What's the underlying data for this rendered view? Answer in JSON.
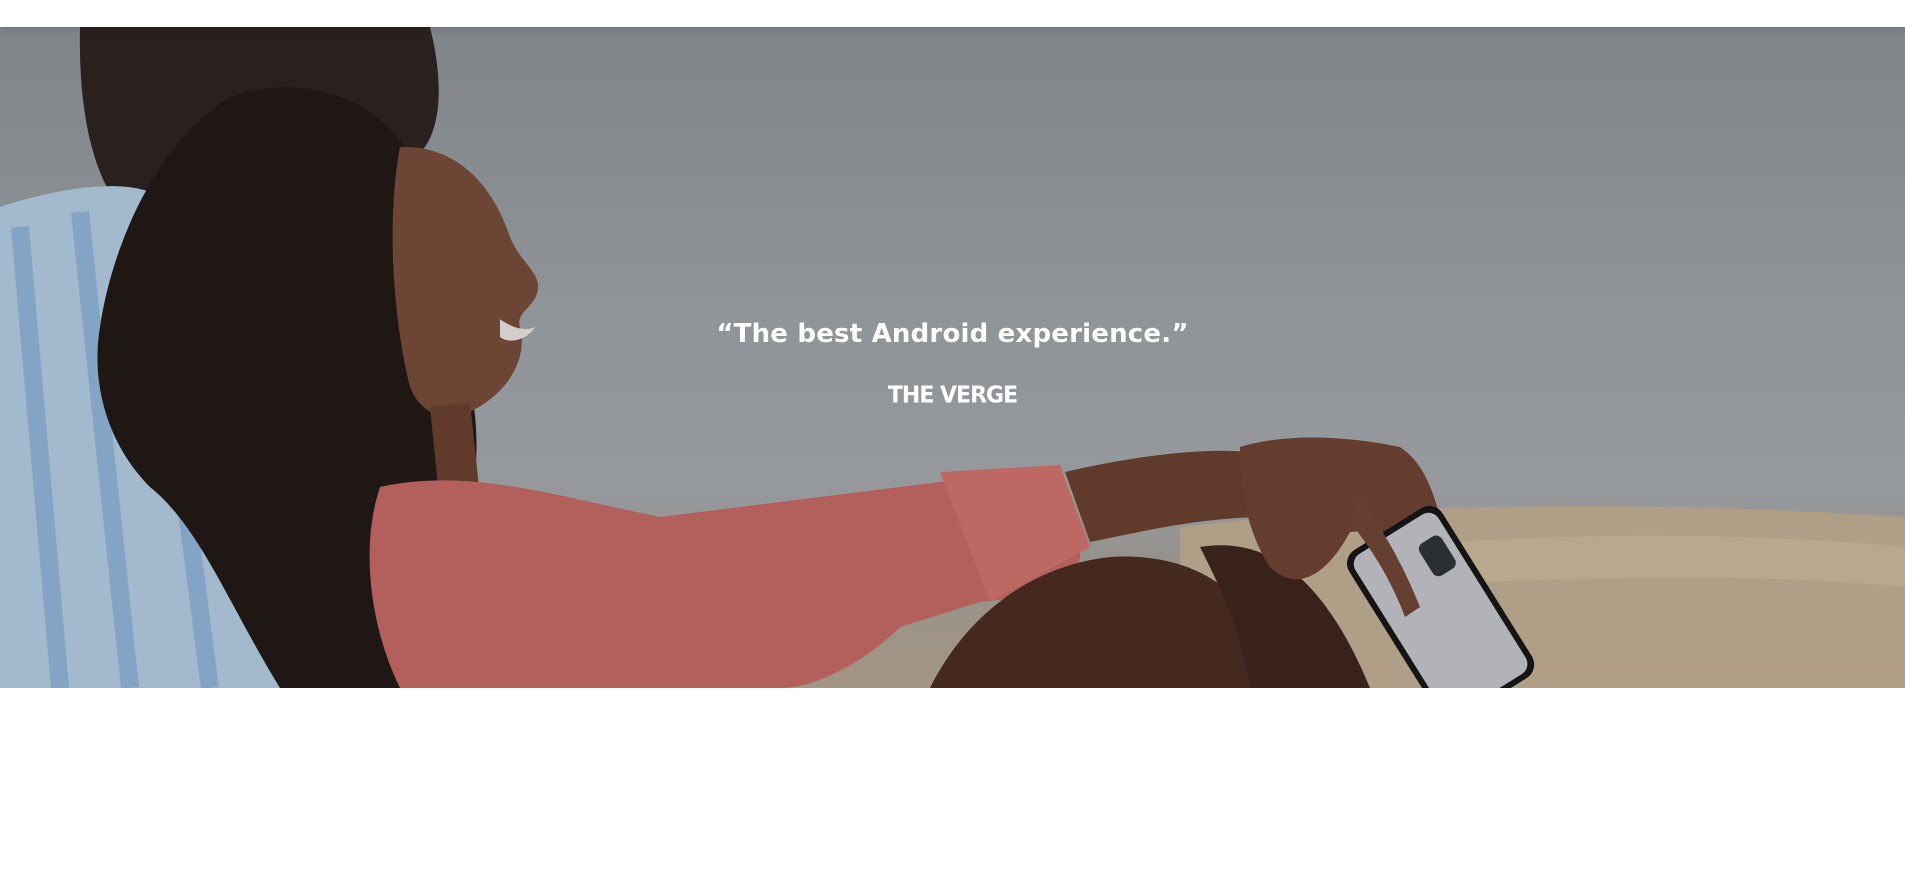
{
  "hero": {
    "quote": "“The best Android experience.”",
    "source_logo_text": "THE VERGE",
    "image_description_icon": "couple-on-beach-photo"
  },
  "colors": {
    "quote_text": "#ffffff",
    "sky": "#9ea3a7",
    "sand": "#c9b394",
    "sweater": "#d46a64",
    "shirt": "#a9cbe8"
  }
}
